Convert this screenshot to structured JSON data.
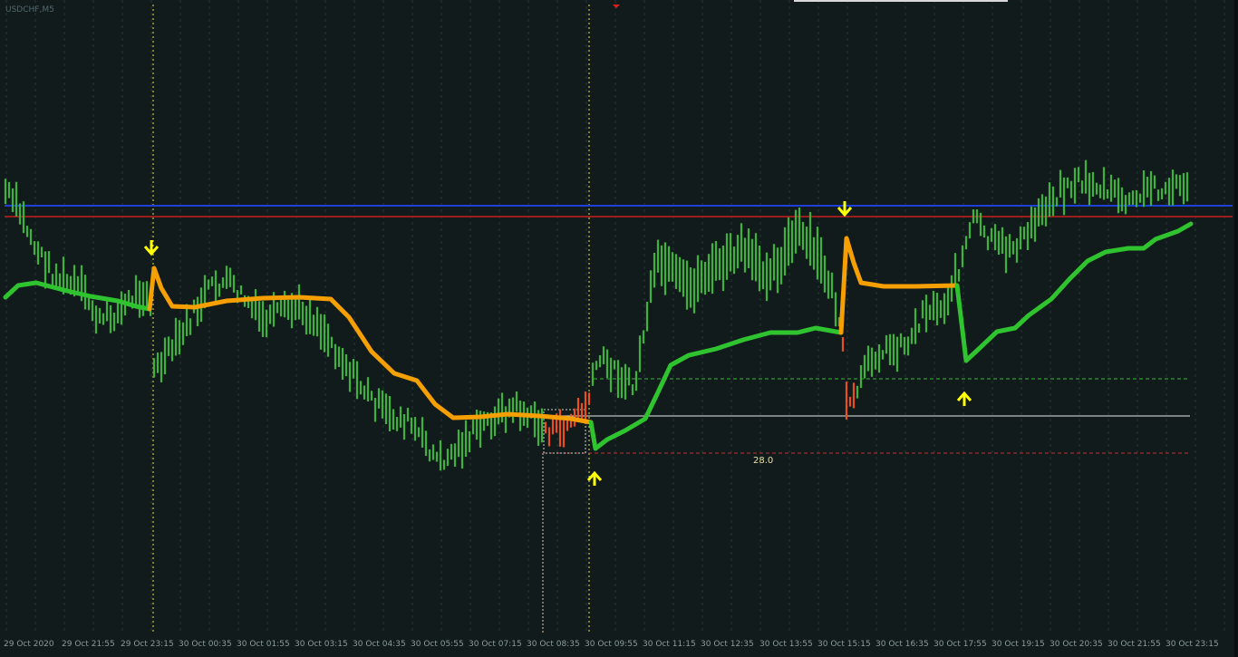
{
  "symbol": "USDCHF,M5",
  "time_labels": [
    "29 Oct 2020",
    "29 Oct 21:55",
    "29 Oct 23:15",
    "30 Oct 00:35",
    "30 Oct 01:55",
    "30 Oct 03:15",
    "30 Oct 04:35",
    "30 Oct 05:55",
    "30 Oct 07:15",
    "30 Oct 08:35",
    "30 Oct 09:55",
    "30 Oct 11:15",
    "30 Oct 12:35",
    "30 Oct 13:55",
    "30 Oct 15:15",
    "30 Oct 16:35",
    "30 Oct 17:55",
    "30 Oct 19:15",
    "30 Oct 20:35",
    "30 Oct 21:55",
    "30 Oct 23:15"
  ],
  "measure_label": "28.0",
  "colors": {
    "background": "#121b1c",
    "bull_bar": "#3cb43c",
    "bear_bar": "#e8501e",
    "ma_up": "#2fc42f",
    "ma_down": "#f5a000",
    "blue_level": "#1f3fd8",
    "red_level": "#c81e1e",
    "signal_arrow": "#ffff00",
    "grid": "#3a4a4c"
  },
  "signals": [
    {
      "type": "down",
      "icon": "arrow-down-icon"
    },
    {
      "type": "up",
      "icon": "arrow-up-icon"
    },
    {
      "type": "down",
      "icon": "arrow-down-icon"
    },
    {
      "type": "up",
      "icon": "arrow-up-icon"
    }
  ]
}
